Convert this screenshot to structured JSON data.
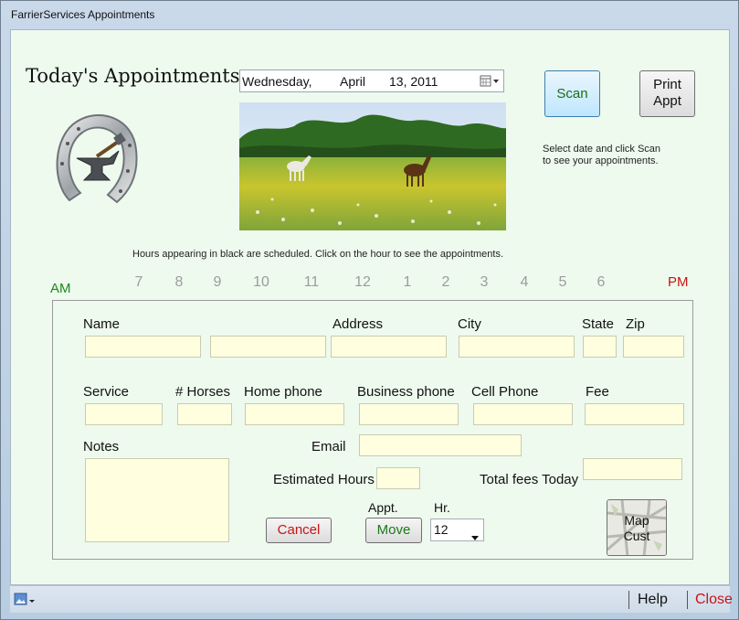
{
  "window": {
    "title": "FarrierServices Appointments"
  },
  "header": {
    "title": "Today's Appointments",
    "date": {
      "weekday": "Wednesday,",
      "month": "April",
      "day_year": "13, 2011"
    },
    "scan_label": "Scan",
    "print_label_1": "Print",
    "print_label_2": "Appt",
    "instructions_1": "Select date and click Scan",
    "instructions_2": "to see your appointments."
  },
  "hours": {
    "note": "Hours appearing in black are scheduled. Click on the hour to see the appointments.",
    "am": "AM",
    "pm": "PM",
    "list": [
      "7",
      "8",
      "9",
      "10",
      "11",
      "12",
      "1",
      "2",
      "3",
      "4",
      "5",
      "6"
    ]
  },
  "form": {
    "name_label": "Name",
    "address_label": "Address",
    "city_label": "City",
    "state_label": "State",
    "zip_label": "Zip",
    "service_label": "Service",
    "horses_label": "# Horses",
    "home_phone_label": "Home phone",
    "business_phone_label": "Business phone",
    "cell_phone_label": "Cell Phone",
    "fee_label": "Fee",
    "notes_label": "Notes",
    "email_label": "Email",
    "est_hours_label": "Estimated Hours",
    "total_fees_label": "Total fees Today",
    "appt_label": "Appt.",
    "hr_label": "Hr.",
    "hr_value": "12",
    "cancel_label": "Cancel",
    "move_label": "Move",
    "map_label_1": "Map",
    "map_label_2": "Cust"
  },
  "status": {
    "help": "Help",
    "close": "Close"
  },
  "colors": {
    "background": "#eefaee",
    "field": "#ffffe0",
    "scan_text": "#1a6e1a",
    "cancel_text": "#c81414",
    "move_text": "#1a7a1a",
    "close_text": "#c81414",
    "am_text": "#1a8a1a",
    "pm_text": "#c81414"
  },
  "icons": [
    "horseshoe-anvil-logo",
    "calendar-dropdown-icon",
    "image-menu-icon",
    "map-icon"
  ]
}
